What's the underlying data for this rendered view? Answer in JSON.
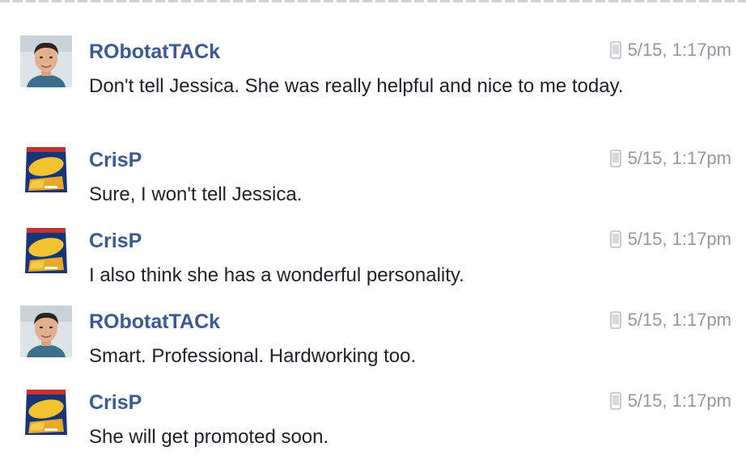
{
  "colors": {
    "sender_name": "#3b5998",
    "timestamp": "#9197a3",
    "message_text": "#1d2129"
  },
  "messages": [
    {
      "sender": "RObotatTACk",
      "avatar": "man-portrait-avatar",
      "timestamp": "5/15, 1:17pm",
      "device_icon": "mobile-phone-icon",
      "text": "Don't tell Jessica. She was really helpful and nice to me today."
    },
    {
      "sender": "CrisP",
      "avatar": "piattos-chips-bag-avatar",
      "timestamp": "5/15, 1:17pm",
      "device_icon": "mobile-phone-icon",
      "text": "Sure, I won't tell Jessica."
    },
    {
      "sender": "CrisP",
      "avatar": "piattos-chips-bag-avatar",
      "timestamp": "5/15, 1:17pm",
      "device_icon": "mobile-phone-icon",
      "text": "I also think she has a wonderful personality."
    },
    {
      "sender": "RObotatTACk",
      "avatar": "man-portrait-avatar",
      "timestamp": "5/15, 1:17pm",
      "device_icon": "mobile-phone-icon",
      "text": "Smart. Professional. Hardworking too."
    },
    {
      "sender": "CrisP",
      "avatar": "piattos-chips-bag-avatar",
      "timestamp": "5/15, 1:17pm",
      "device_icon": "mobile-phone-icon",
      "text": "She will get promoted soon."
    }
  ]
}
